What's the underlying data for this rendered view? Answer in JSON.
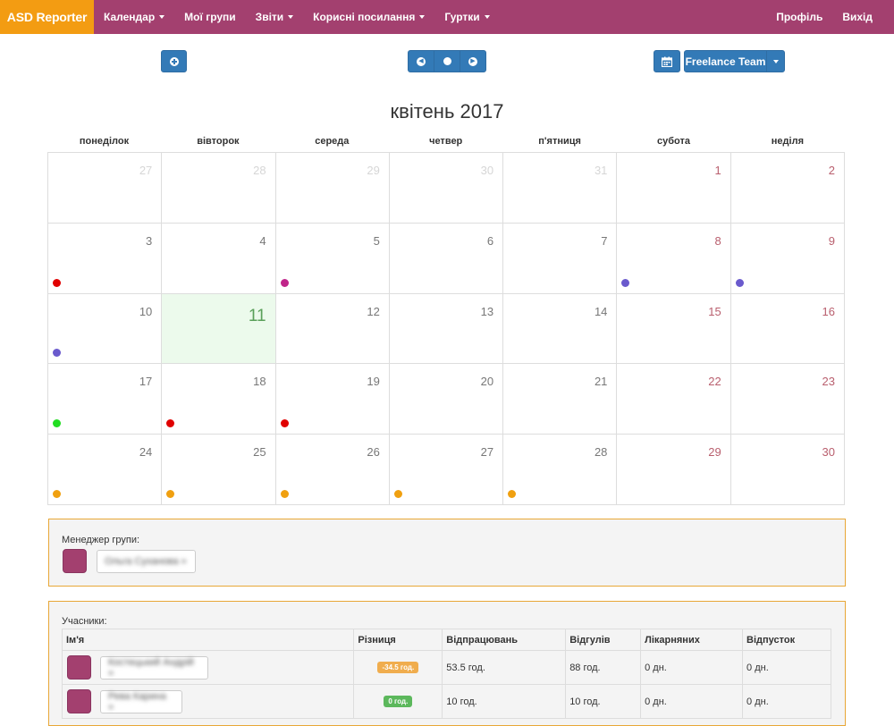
{
  "navbar": {
    "brand": "ASD Reporter",
    "items": [
      {
        "label": "Календар",
        "dropdown": true
      },
      {
        "label": "Мої групи",
        "dropdown": false
      },
      {
        "label": "Звіти",
        "dropdown": true
      },
      {
        "label": "Корисні посилання",
        "dropdown": true
      },
      {
        "label": "Гуртки",
        "dropdown": true
      }
    ],
    "right_items": [
      {
        "label": "Профіль"
      },
      {
        "label": "Вихід"
      }
    ]
  },
  "toolbar": {
    "team_select": "Freelance Team"
  },
  "calendar": {
    "title": "квітень 2017",
    "weekdays": [
      "понеділок",
      "вівторок",
      "середа",
      "четвер",
      "п'ятниця",
      "субота",
      "неділя"
    ],
    "weeks": [
      [
        {
          "day": "27",
          "other": true
        },
        {
          "day": "28",
          "other": true
        },
        {
          "day": "29",
          "other": true
        },
        {
          "day": "30",
          "other": true
        },
        {
          "day": "31",
          "other": true
        },
        {
          "day": "1",
          "weekend": true
        },
        {
          "day": "2",
          "weekend": true
        }
      ],
      [
        {
          "day": "3",
          "dot": "#e00000"
        },
        {
          "day": "4"
        },
        {
          "day": "5",
          "dot": "#c0258a"
        },
        {
          "day": "6"
        },
        {
          "day": "7"
        },
        {
          "day": "8",
          "weekend": true,
          "dot": "#6a5acd"
        },
        {
          "day": "9",
          "weekend": true,
          "dot": "#6a5acd"
        }
      ],
      [
        {
          "day": "10",
          "dot": "#6a5acd"
        },
        {
          "day": "11",
          "today": true
        },
        {
          "day": "12"
        },
        {
          "day": "13"
        },
        {
          "day": "14"
        },
        {
          "day": "15",
          "weekend": true
        },
        {
          "day": "16",
          "weekend": true
        }
      ],
      [
        {
          "day": "17",
          "dot": "#22dd22"
        },
        {
          "day": "18",
          "dot": "#e00000"
        },
        {
          "day": "19",
          "dot": "#e00000"
        },
        {
          "day": "20"
        },
        {
          "day": "21"
        },
        {
          "day": "22",
          "weekend": true
        },
        {
          "day": "23",
          "weekend": true
        }
      ],
      [
        {
          "day": "24",
          "dot": "#f0a010"
        },
        {
          "day": "25",
          "dot": "#f0a010"
        },
        {
          "day": "26",
          "dot": "#f0a010"
        },
        {
          "day": "27",
          "dot": "#f0a010"
        },
        {
          "day": "28",
          "dot": "#f0a010"
        },
        {
          "day": "29",
          "weekend": true
        },
        {
          "day": "30",
          "weekend": true
        }
      ]
    ]
  },
  "manager": {
    "label": "Менеджер групи:",
    "name": "Ольга Суханова »"
  },
  "members": {
    "label": "Учасники:",
    "headers": [
      "Ім'я",
      "Різниця",
      "Відпрацювань",
      "Відгулів",
      "Лікарняних",
      "Відпусток"
    ],
    "rows": [
      {
        "name": "Костецький Андрій »",
        "diff": "-34.5 год.",
        "diff_color": "#f0ad4e",
        "worked": "53.5 год.",
        "offs": "88 год.",
        "sick": "0 дн.",
        "vacation": "0 дн."
      },
      {
        "name": "Рева Карина »",
        "diff": "0 год.",
        "diff_color": "#5cb85c",
        "worked": "10 год.",
        "offs": "10 год.",
        "sick": "0 дн.",
        "vacation": "0 дн."
      }
    ]
  },
  "colors": {
    "navbar": "#a3406f",
    "brand": "#f39c12",
    "primary": "#337ab7",
    "panel_border": "#e8a736"
  }
}
